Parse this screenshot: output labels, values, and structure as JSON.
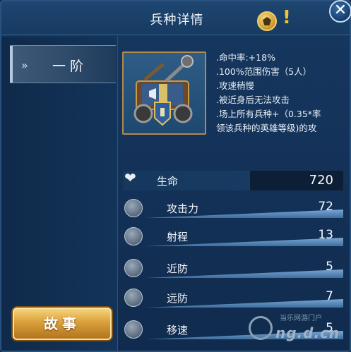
{
  "window": {
    "title": "兵种详情",
    "exclaim": "!",
    "close_glyph": "✕"
  },
  "sidebar": {
    "tier_label": "一阶",
    "tier_arrow": "»",
    "story_button": "故事"
  },
  "unit": {
    "description": [
      ".命中率:+18%",
      ".100%范围伤害（5人）",
      ".攻速稍慢",
      ".被近身后无法攻击",
      ".场上所有兵种+（0.35*率",
      "领该兵种的英雄等级)的攻"
    ]
  },
  "stats": {
    "hp": {
      "name": "生命",
      "value": "720",
      "icon": "heart-icon"
    },
    "rows": [
      {
        "name": "攻击力",
        "value": "72",
        "icon": "crossed-swords-icon"
      },
      {
        "name": "射程",
        "value": "13",
        "icon": "target-icon"
      },
      {
        "name": "近防",
        "value": "5",
        "icon": "melee-armor-icon"
      },
      {
        "name": "远防",
        "value": "7",
        "icon": "ranged-shield-icon"
      },
      {
        "name": "移速",
        "value": "5",
        "icon": "speed-boot-icon"
      }
    ]
  },
  "watermark": {
    "top": "当乐网游门户",
    "main": "ng.d.cn"
  },
  "colors": {
    "background": "#14335a",
    "accent_gold": "#d9a03a",
    "bar_blue": "#5f8fbf"
  }
}
